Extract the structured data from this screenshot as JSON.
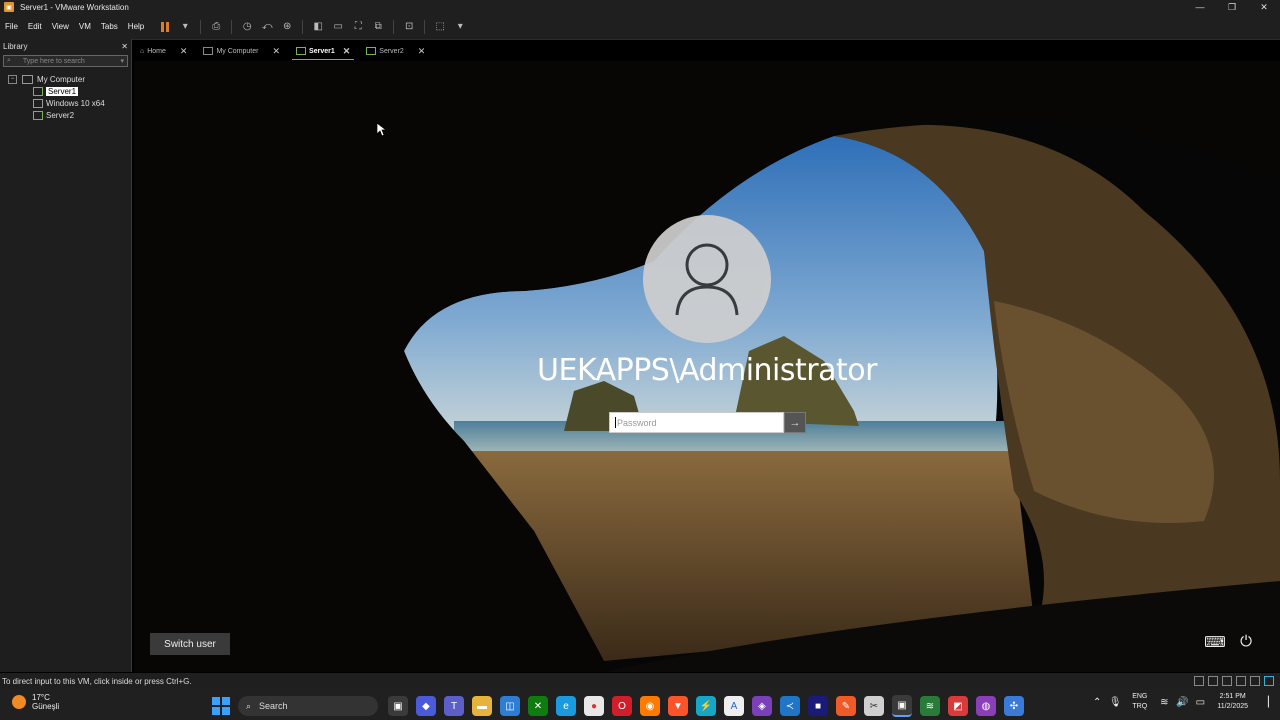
{
  "window": {
    "title": "Server1 - VMware Workstation",
    "minimize": "—",
    "maximize": "❐",
    "close": "✕"
  },
  "menu": [
    "File",
    "Edit",
    "View",
    "VM",
    "Tabs",
    "Help"
  ],
  "library": {
    "title": "Library",
    "close": "✕",
    "search_placeholder": "Type here to search",
    "tree": {
      "root": "My Computer",
      "items": [
        "Server1",
        "Windows 10 x64",
        "Server2"
      ]
    }
  },
  "tabs": [
    {
      "label": "Home",
      "close": "✕"
    },
    {
      "label": "My Computer",
      "close": "✕"
    },
    {
      "label": "Server1",
      "close": "✕"
    },
    {
      "label": "Server2",
      "close": "✕"
    }
  ],
  "login": {
    "username": "UEKAPPS\\Administrator",
    "password_placeholder": "Password",
    "submit": "→",
    "switch_user": "Switch user"
  },
  "vm_icons": {
    "accessibility": "⌨",
    "power": "⏻"
  },
  "status": "To direct input to this VM, click inside or press Ctrl+G.",
  "taskbar": {
    "weather_temp": "17°C",
    "weather_desc": "Güneşli",
    "search": "Search",
    "lang_top": "ENG",
    "lang_bottom": "TRQ",
    "time": "2:51 PM",
    "date": "11/2/2025"
  }
}
